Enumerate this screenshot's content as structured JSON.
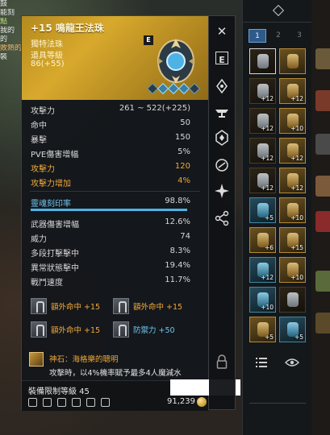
{
  "background": {
    "left_text_lines": [
      "鼓",
      "能刻",
      "點",
      "我的",
      "的",
      "敗熱的",
      "裝"
    ]
  },
  "tooltip": {
    "title": "+15 鳴龍王法珠",
    "category": "獨特法珠",
    "level_label": "道具等級",
    "item_level": "86(+55)",
    "badge": "E",
    "stats": [
      {
        "label": "攻擊力",
        "value": "261 ~ 522(+225)",
        "highlight": false
      },
      {
        "label": "命中",
        "value": "50",
        "highlight": false
      },
      {
        "label": "暴擊",
        "value": "150",
        "highlight": false
      },
      {
        "label": "PVE傷害增幅",
        "value": "5%",
        "highlight": false
      },
      {
        "label": "攻擊力",
        "value": "120",
        "highlight": true
      },
      {
        "label": "攻擊力增加",
        "value": "4%",
        "highlight": true
      }
    ],
    "seal": {
      "label": "靈魂刻印率",
      "value": "98.8%",
      "fill": 0.988
    },
    "stats2": [
      {
        "label": "武器傷害增幅",
        "value": "12.6%"
      },
      {
        "label": "威力",
        "value": "74"
      },
      {
        "label": "多段打擊擊中",
        "value": "8.3%"
      },
      {
        "label": "異常狀態擊中",
        "value": "19.4%"
      },
      {
        "label": "戰鬥速度",
        "value": "11.7%"
      }
    ],
    "bonuses": [
      {
        "label": "額外命中 +15",
        "color": "orange"
      },
      {
        "label": "額外命中 +15",
        "color": "orange"
      },
      {
        "label": "額外命中 +15",
        "color": "orange"
      },
      {
        "label": "防禦力 +50",
        "color": "blue"
      }
    ],
    "gem": {
      "title": "神石：海格樂的聰明",
      "description": "攻擊時，以4%機率賦予最多4人魔減水"
    },
    "requirement": "裝備限制等級 45",
    "price": "91,239"
  },
  "sidebar": {
    "close_glyph": "✕",
    "equip_glyph": "E",
    "lock_glyph": "🔒"
  },
  "inventory": {
    "tabs": [
      "1",
      "2",
      "3"
    ],
    "active_tab": "1",
    "slots": [
      {
        "style": "sel",
        "enh": ""
      },
      {
        "style": "gold",
        "enh": ""
      },
      {
        "style": "plain",
        "enh": "+12"
      },
      {
        "style": "gold",
        "enh": "+12"
      },
      {
        "style": "plain",
        "enh": "+12"
      },
      {
        "style": "gold",
        "enh": "+10"
      },
      {
        "style": "plain",
        "enh": "+12"
      },
      {
        "style": "gold",
        "enh": "+12"
      },
      {
        "style": "plain",
        "enh": "+12"
      },
      {
        "style": "gold",
        "enh": "+12"
      },
      {
        "style": "blue",
        "enh": "+5"
      },
      {
        "style": "gold",
        "enh": "+10"
      },
      {
        "style": "gold",
        "enh": "+6"
      },
      {
        "style": "gold",
        "enh": "+15"
      },
      {
        "style": "blue",
        "enh": "+12"
      },
      {
        "style": "gold",
        "enh": "+10"
      },
      {
        "style": "blue",
        "enh": "+10"
      },
      {
        "style": "plain",
        "enh": ""
      },
      {
        "style": "gold",
        "enh": "+5"
      },
      {
        "style": "blue",
        "enh": "+5"
      }
    ]
  },
  "colors": {
    "header_gold": "#d8a92c",
    "highlight": "#f0a83a",
    "blue": "#6fc6ef",
    "tab_active": "#2e5a8a"
  }
}
